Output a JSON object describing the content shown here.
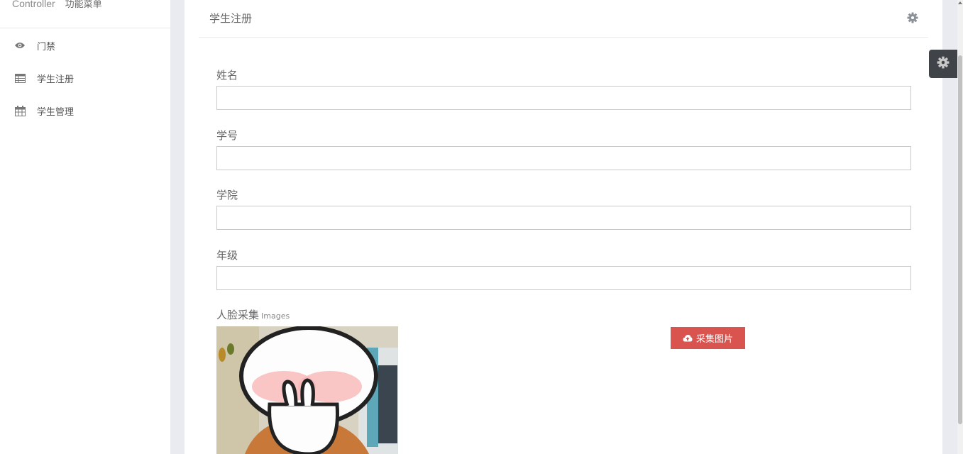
{
  "sidebar": {
    "brand": "Controller",
    "menu_title": "功能菜单",
    "items": [
      {
        "label": "门禁",
        "icon": "eye-icon"
      },
      {
        "label": "学生注册",
        "icon": "table-icon"
      },
      {
        "label": "学生管理",
        "icon": "calendar-icon"
      }
    ]
  },
  "panel": {
    "title": "学生注册",
    "fields": [
      {
        "label": "姓名",
        "value": ""
      },
      {
        "label": "学号",
        "value": ""
      },
      {
        "label": "学院",
        "value": ""
      },
      {
        "label": "年级",
        "value": ""
      }
    ],
    "face_label": "人脸采集",
    "face_sublabel": "Images",
    "capture_button": "采集图片"
  },
  "colors": {
    "danger": "#d9534f",
    "settings_tab": "#404448",
    "background": "#e9ebf0"
  }
}
